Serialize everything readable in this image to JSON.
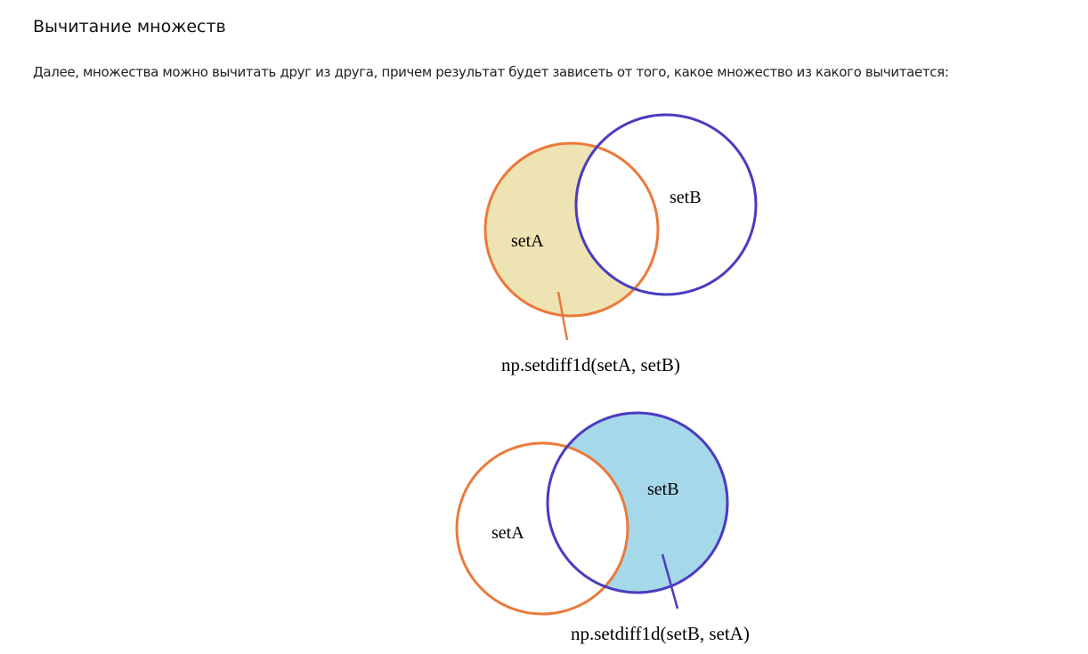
{
  "section": {
    "heading": "Вычитание множеств",
    "paragraph": "Далее, множества можно вычитать друг из друга, причем результат будет зависеть от того, какое множество из какого вычитается:"
  },
  "diagrams": [
    {
      "label_a": "setA",
      "label_b": "setB",
      "caption": "np.setdiff1d(setA, setB)",
      "highlighted_set": "setA"
    },
    {
      "label_a": "setA",
      "label_b": "setB",
      "caption": "np.setdiff1d(setB, setA)",
      "highlighted_set": "setB"
    }
  ],
  "colors": {
    "set_a_stroke": "#ea7a3a",
    "set_b_stroke": "#4a3cc0",
    "set_a_fill": "#ede3b3",
    "set_b_fill": "#a5d8e9"
  }
}
